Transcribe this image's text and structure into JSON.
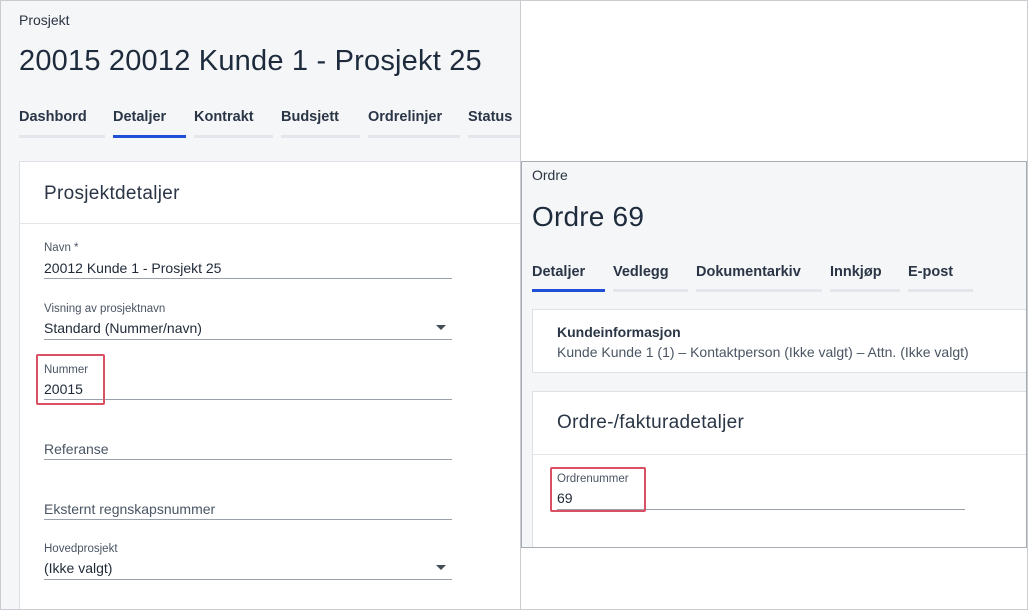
{
  "project": {
    "eyebrow": "Prosjekt",
    "title": "20015 20012 Kunde 1 - Prosjekt 25",
    "tabs": [
      {
        "label": "Dashbord",
        "active": false
      },
      {
        "label": "Detaljer",
        "active": true
      },
      {
        "label": "Kontrakt",
        "active": false
      },
      {
        "label": "Budsjett",
        "active": false
      },
      {
        "label": "Ordrelinjer",
        "active": false
      },
      {
        "label": "Status",
        "active": false
      }
    ],
    "card_title": "Prosjektdetaljer",
    "fields": {
      "navn": {
        "label": "Navn *",
        "value": "20012 Kunde 1 - Prosjekt 25"
      },
      "visning": {
        "label": "Visning av prosjektnavn",
        "value": "Standard (Nummer/navn)"
      },
      "nummer": {
        "label": "Nummer",
        "value": "20015"
      },
      "referanse": {
        "placeholder": "Referanse"
      },
      "eksternt": {
        "placeholder": "Eksternt regnskapsnummer"
      },
      "hovedprosjekt": {
        "label": "Hovedprosjekt",
        "value": "(Ikke valgt)"
      }
    }
  },
  "order": {
    "eyebrow": "Ordre",
    "title": "Ordre 69",
    "tabs": [
      {
        "label": "Detaljer",
        "active": true
      },
      {
        "label": "Vedlegg",
        "active": false
      },
      {
        "label": "Dokumentarkiv",
        "active": false
      },
      {
        "label": "Innkjøp",
        "active": false
      },
      {
        "label": "E-post",
        "active": false
      }
    ],
    "customer": {
      "title": "Kundeinformasjon",
      "text": "Kunde Kunde 1 (1) – Kontaktperson (Ikke valgt) – Attn. (Ikke valgt)"
    },
    "card_title": "Ordre-/fakturadetaljer",
    "ordrenummer": {
      "label": "Ordrenummer",
      "value": "69"
    }
  },
  "colors": {
    "accent": "#1f4fd6",
    "highlight": "#d94f63"
  }
}
